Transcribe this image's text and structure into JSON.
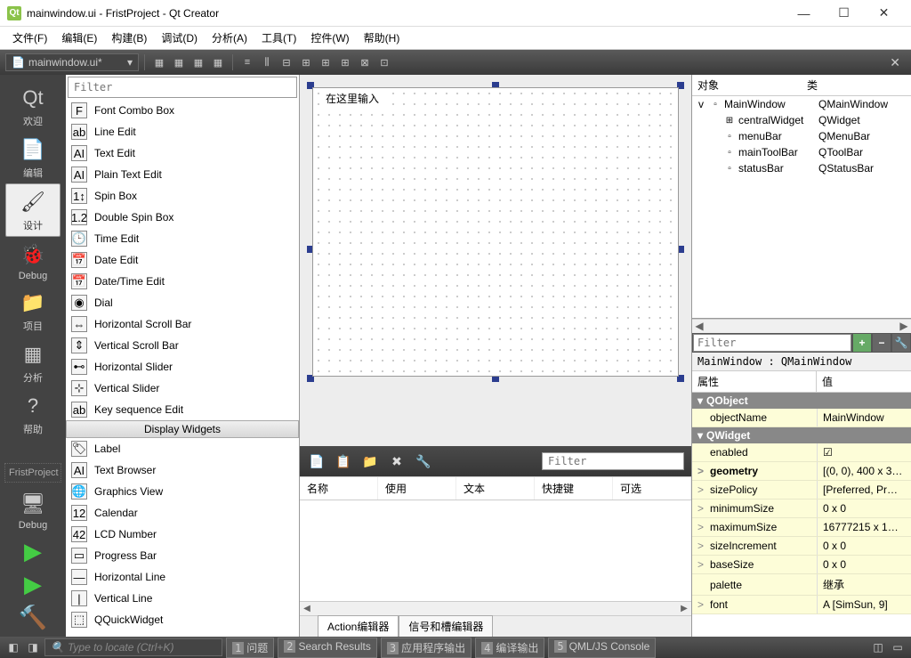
{
  "window": {
    "title": "mainwindow.ui - FristProject - Qt Creator"
  },
  "menubar": [
    "文件(F)",
    "编辑(E)",
    "构建(B)",
    "调试(D)",
    "分析(A)",
    "工具(T)",
    "控件(W)",
    "帮助(H)"
  ],
  "toolbar": {
    "file": "mainwindow.ui*"
  },
  "rail": [
    {
      "label": "欢迎",
      "icon": "Qt"
    },
    {
      "label": "编辑",
      "icon": "📄"
    },
    {
      "label": "设计",
      "icon": "🖌",
      "active": true
    },
    {
      "label": "Debug",
      "icon": "🐞"
    },
    {
      "label": "项目",
      "icon": "📁"
    },
    {
      "label": "分析",
      "icon": "▦"
    },
    {
      "label": "帮助",
      "icon": "?"
    }
  ],
  "rail_project": "FristProject",
  "rail_debug": "Debug",
  "widget_filter": "Filter",
  "widget_group_header": "Display Widgets",
  "widgets_top": [
    {
      "label": "Font Combo Box",
      "icon": "F"
    },
    {
      "label": "Line Edit",
      "icon": "ab"
    },
    {
      "label": "Text Edit",
      "icon": "AI"
    },
    {
      "label": "Plain Text Edit",
      "icon": "AI"
    },
    {
      "label": "Spin Box",
      "icon": "1↕"
    },
    {
      "label": "Double Spin Box",
      "icon": "1.2"
    },
    {
      "label": "Time Edit",
      "icon": "🕒"
    },
    {
      "label": "Date Edit",
      "icon": "📅"
    },
    {
      "label": "Date/Time Edit",
      "icon": "📅"
    },
    {
      "label": "Dial",
      "icon": "◉"
    },
    {
      "label": "Horizontal Scroll Bar",
      "icon": "⇔"
    },
    {
      "label": "Vertical Scroll Bar",
      "icon": "⇕"
    },
    {
      "label": "Horizontal Slider",
      "icon": "⊷"
    },
    {
      "label": "Vertical Slider",
      "icon": "⊹"
    },
    {
      "label": "Key sequence Edit",
      "icon": "ab"
    }
  ],
  "widgets_display": [
    {
      "label": "Label",
      "icon": "🏷"
    },
    {
      "label": "Text Browser",
      "icon": "AI"
    },
    {
      "label": "Graphics View",
      "icon": "🌐"
    },
    {
      "label": "Calendar",
      "icon": "12"
    },
    {
      "label": "LCD Number",
      "icon": "42"
    },
    {
      "label": "Progress Bar",
      "icon": "▭"
    },
    {
      "label": "Horizontal Line",
      "icon": "—"
    },
    {
      "label": "Vertical Line",
      "icon": "|"
    },
    {
      "label": "QQuickWidget",
      "icon": "⬚"
    }
  ],
  "form_label": "在这里输入",
  "action_filter": "Filter",
  "action_columns": [
    "名称",
    "使用",
    "文本",
    "快捷键",
    "可选"
  ],
  "action_tabs": [
    "Action编辑器",
    "信号和槽编辑器"
  ],
  "obj_header": [
    "对象",
    "类"
  ],
  "obj_tree": [
    {
      "name": "MainWindow",
      "class": "QMainWindow",
      "level": 0,
      "exp": "v"
    },
    {
      "name": "centralWidget",
      "class": "QWidget",
      "level": 1,
      "icon": "⊞"
    },
    {
      "name": "menuBar",
      "class": "QMenuBar",
      "level": 1
    },
    {
      "name": "mainToolBar",
      "class": "QToolBar",
      "level": 1
    },
    {
      "name": "statusBar",
      "class": "QStatusBar",
      "level": 1
    }
  ],
  "prop_filter": "Filter",
  "prop_bread": "MainWindow : QMainWindow",
  "prop_header": [
    "属性",
    "值"
  ],
  "prop_groups": [
    {
      "name": "QObject",
      "rows": [
        {
          "name": "objectName",
          "val": "MainWindow",
          "exp": ""
        }
      ]
    },
    {
      "name": "QWidget",
      "rows": [
        {
          "name": "enabled",
          "val": "☑",
          "exp": ""
        },
        {
          "name": "geometry",
          "val": "[(0, 0), 400 x 3…",
          "exp": ">",
          "bold": true
        },
        {
          "name": "sizePolicy",
          "val": "[Preferred, Pr…",
          "exp": ">"
        },
        {
          "name": "minimumSize",
          "val": "0 x 0",
          "exp": ">"
        },
        {
          "name": "maximumSize",
          "val": "16777215 x 1…",
          "exp": ">"
        },
        {
          "name": "sizeIncrement",
          "val": "0 x 0",
          "exp": ">"
        },
        {
          "name": "baseSize",
          "val": "0 x 0",
          "exp": ">"
        },
        {
          "name": "palette",
          "val": "继承",
          "exp": ""
        },
        {
          "name": "font",
          "val": "A  [SimSun, 9]",
          "exp": ">"
        }
      ]
    }
  ],
  "status": {
    "locate": "Type to locate (Ctrl+K)",
    "tabs": [
      {
        "n": "1",
        "t": "问题"
      },
      {
        "n": "2",
        "t": "Search Results"
      },
      {
        "n": "3",
        "t": "应用程序输出"
      },
      {
        "n": "4",
        "t": "编译输出"
      },
      {
        "n": "5",
        "t": "QML/JS Console"
      }
    ]
  }
}
